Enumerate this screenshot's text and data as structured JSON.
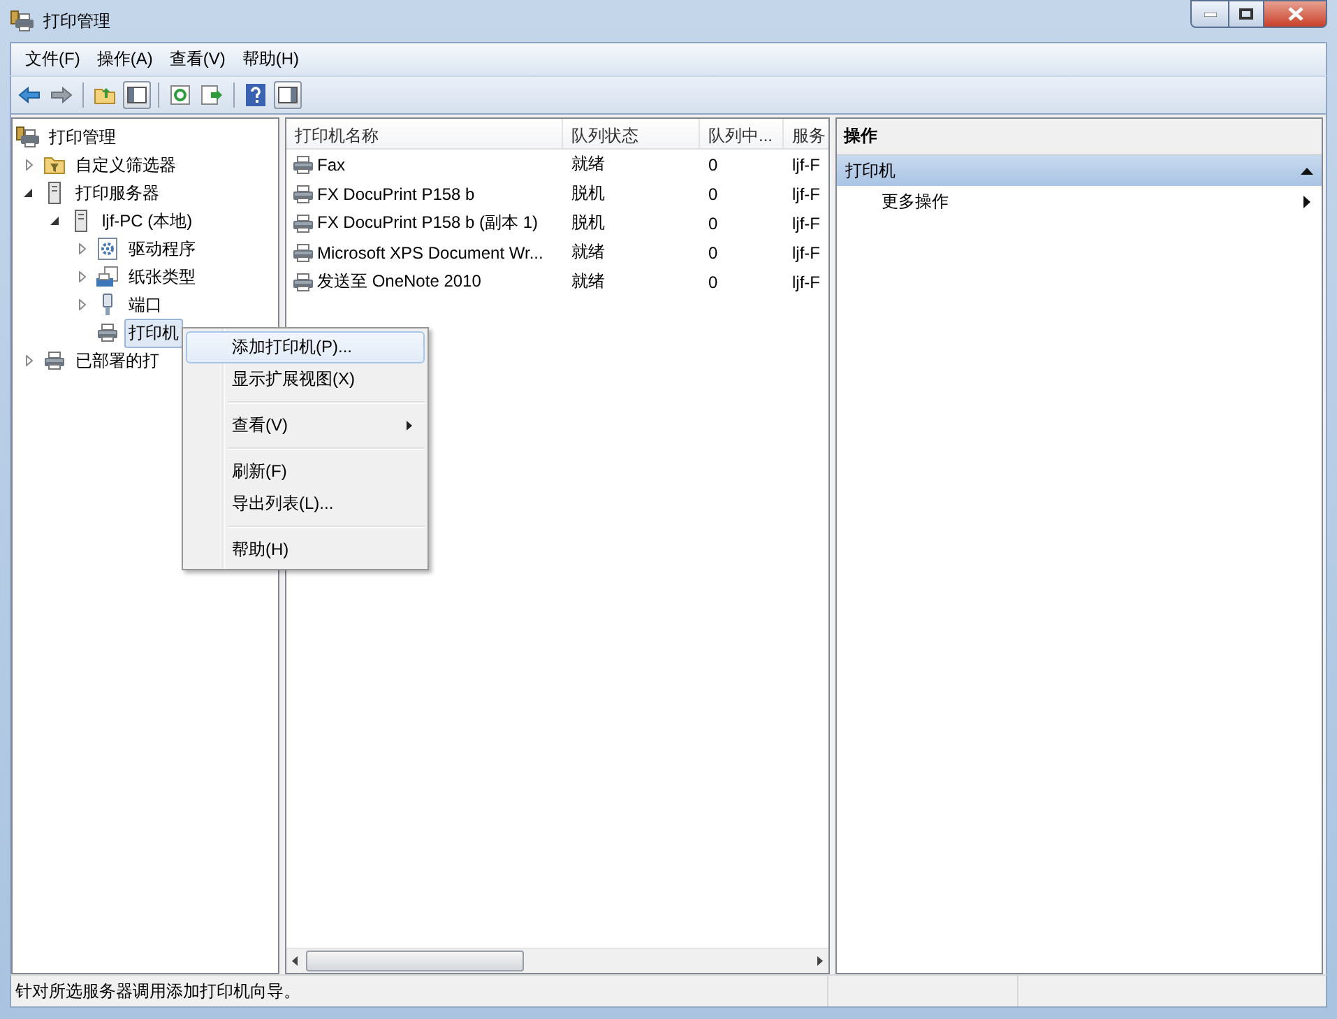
{
  "window": {
    "title": "打印管理"
  },
  "menu_bar": [
    "文件(F)",
    "操作(A)",
    "查看(V)",
    "帮助(H)"
  ],
  "tree": [
    {
      "label": "打印管理",
      "kind": "root",
      "selected": false,
      "children": [
        {
          "label": "自定义筛选器",
          "kind": "filter",
          "expanded": false,
          "selected": false
        },
        {
          "label": "打印服务器",
          "kind": "server",
          "expanded": true,
          "selected": false,
          "children": [
            {
              "label": "ljf-PC (本地)",
              "kind": "server",
              "expanded": true,
              "selected": false,
              "children": [
                {
                  "label": "驱动程序",
                  "kind": "driver",
                  "expanded": false,
                  "selected": false
                },
                {
                  "label": "纸张类型",
                  "kind": "forms",
                  "expanded": false,
                  "selected": false
                },
                {
                  "label": "端口",
                  "kind": "port",
                  "expanded": false,
                  "selected": false
                },
                {
                  "label": "打印机",
                  "kind": "printer",
                  "selected": true
                }
              ]
            }
          ]
        },
        {
          "label": "已部署的打",
          "kind": "printer",
          "expanded": false,
          "selected": false
        }
      ]
    }
  ],
  "table": {
    "columns": [
      "打印机名称",
      "队列状态",
      "队列中...",
      "服务"
    ],
    "rows": [
      [
        "Fax",
        "就绪",
        "0",
        "ljf-F"
      ],
      [
        "FX DocuPrint P158 b",
        "脱机",
        "0",
        "ljf-F"
      ],
      [
        "FX DocuPrint P158 b (副本 1)",
        "脱机",
        "0",
        "ljf-F"
      ],
      [
        "Microsoft XPS Document Wr...",
        "就绪",
        "0",
        "ljf-F"
      ],
      [
        "发送至 OneNote 2010",
        "就绪",
        "0",
        "ljf-F"
      ]
    ]
  },
  "actions": {
    "title": "操作",
    "sections": [
      {
        "title": "打印机",
        "expanded": true,
        "items": [
          {
            "label": "更多操作",
            "submenu": true
          }
        ]
      }
    ]
  },
  "context_menu": {
    "groups": [
      [
        {
          "label": "添加打印机(P)...",
          "selected": true,
          "submenu": false
        },
        {
          "label": "显示扩展视图(X)",
          "selected": false,
          "submenu": false
        }
      ],
      [
        {
          "label": "查看(V)",
          "selected": false,
          "submenu": true
        }
      ],
      [
        {
          "label": "刷新(F)",
          "selected": false,
          "submenu": false
        },
        {
          "label": "导出列表(L)...",
          "selected": false,
          "submenu": false
        }
      ],
      [
        {
          "label": "帮助(H)",
          "selected": false,
          "submenu": false
        }
      ]
    ]
  },
  "status_bar": "针对所选服务器调用添加打印机向导。"
}
